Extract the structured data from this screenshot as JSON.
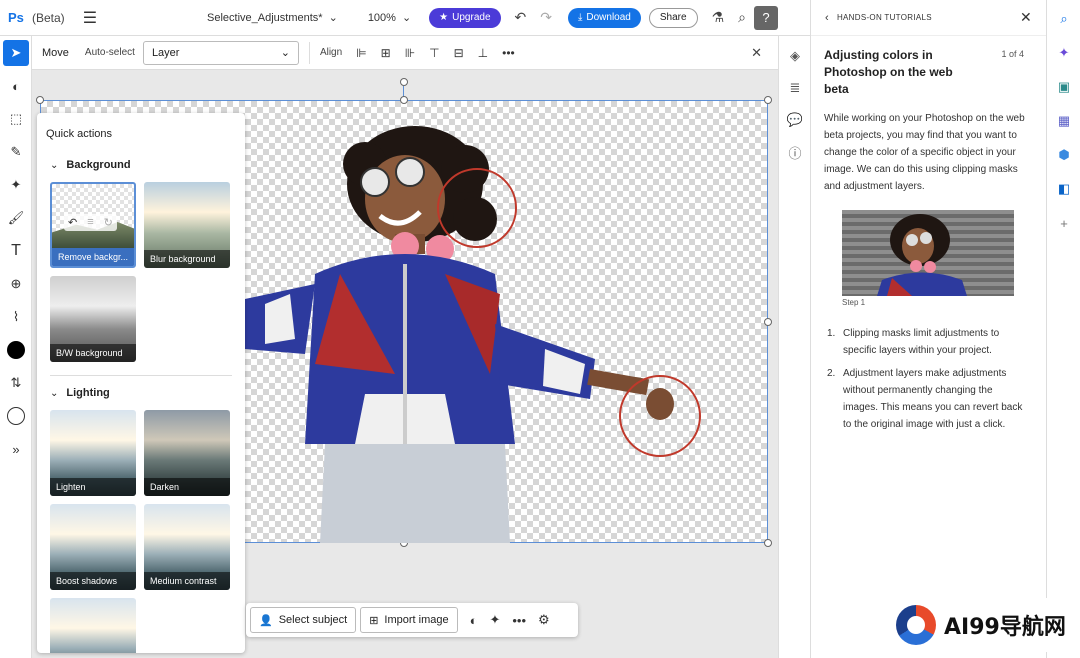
{
  "header": {
    "app_logo": "Ps",
    "beta_label": "(Beta)",
    "document_name": "Selective_Adjustments*",
    "zoom": "100%",
    "upgrade_label": "Upgrade",
    "download_label": "Download",
    "share_label": "Share"
  },
  "options": {
    "move_label": "Move",
    "auto_select_label": "Auto-select",
    "layer_select_value": "Layer",
    "align_label": "Align"
  },
  "quick_actions": {
    "title": "Quick actions",
    "sections": [
      {
        "name": "Background",
        "items": [
          "Remove backgr...",
          "Blur background",
          "B/W background"
        ]
      },
      {
        "name": "Lighting",
        "items": [
          "Lighten",
          "Darken",
          "Boost shadows",
          "Medium contrast"
        ]
      }
    ]
  },
  "float_bar": {
    "select_subject": "Select subject",
    "import_image": "Import image"
  },
  "tutorial": {
    "header": "HANDS-ON TUTORIALS",
    "title": "Adjusting colors in Photoshop on the web beta",
    "page": "1 of 4",
    "body": "While working on your Photoshop on the web beta projects, you may find that you want to change the color of a specific object in your image. We can do this using clipping masks and adjustment layers.",
    "image_caption": "Step 1",
    "list": [
      "Clipping masks limit adjustments to specific layers within your project.",
      "Adjustment layers make adjustments without permanently changing the images. This means you can revert back to the original image with just a click."
    ]
  },
  "watermark": "AI99导航网",
  "colors": {
    "accent": "#1473e6",
    "upgrade": "#4b3bd8",
    "ring": "#c0392b"
  }
}
